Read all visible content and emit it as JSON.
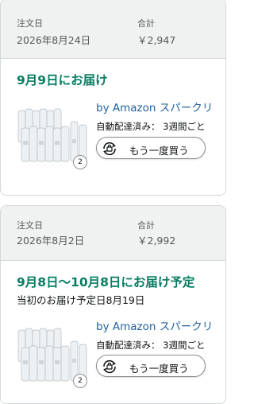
{
  "orders": [
    {
      "order_date_label": "注文日",
      "order_date": "2026年8月24日",
      "total_label": "合計",
      "total": "￥2,947",
      "delivery_status": "9月9日にお届け",
      "original_delivery": "",
      "product_name": "by Amazon スパークリ",
      "quantity": "2",
      "subscription_status": "自動配達済み： 3週間ごと",
      "buy_again_label": "もう一度買う"
    },
    {
      "order_date_label": "注文日",
      "order_date": "2026年8月2日",
      "total_label": "合計",
      "total": "￥2,992",
      "delivery_status": "9月8日～10月8日にお届け予定",
      "original_delivery": "当初のお届け予定日8月19日",
      "product_name": "by Amazon スパークリ",
      "quantity": "2",
      "subscription_status": "自動配達済み： 3週間ごと",
      "buy_again_label": "もう一度買う"
    }
  ],
  "colors": {
    "delivery_green": "#067d62",
    "link_blue": "#2162a1",
    "header_bg": "#f0f2f2",
    "border": "#d5d9d9"
  }
}
